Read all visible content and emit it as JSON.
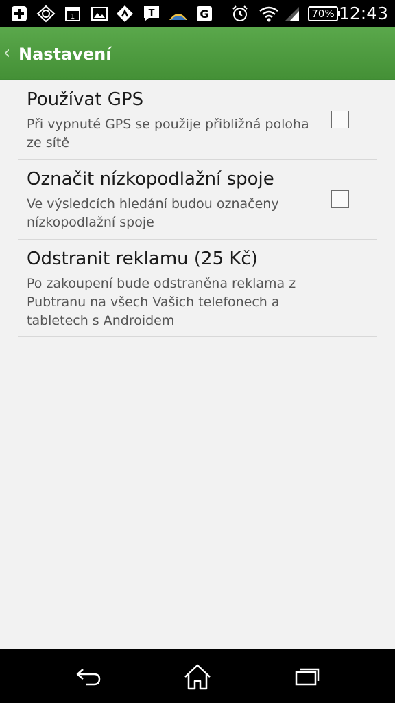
{
  "status_bar": {
    "time": "12:43",
    "battery_percent": "70%",
    "icons": [
      "add-icon",
      "app-icon",
      "calendar-icon",
      "gallery-icon",
      "map-icon",
      "message-icon",
      "weather-icon",
      "g-icon",
      "alarm-icon",
      "wifi-icon",
      "signal-icon",
      "battery-icon"
    ]
  },
  "action_bar": {
    "back_glyph": "‹",
    "title": "Nastavení",
    "color": "#4c9d3f"
  },
  "preferences": [
    {
      "title": "Používat GPS",
      "summary": "Při vypnuté GPS se použije přibližná poloha ze sítě",
      "has_checkbox": true,
      "checked": false
    },
    {
      "title": "Označit nízkopodlažní spoje",
      "summary": "Ve výsledcích hledání budou označeny nízkopodlažní spoje",
      "has_checkbox": true,
      "checked": false
    },
    {
      "title": "Odstranit reklamu (25 Kč)",
      "summary": "Po zakoupení bude odstraněna reklama z Pubtranu na všech Vašich telefonech a tabletech s Androidem",
      "has_checkbox": false
    }
  ],
  "nav_bar": {
    "icons": [
      "back-icon",
      "home-icon",
      "recent-apps-icon"
    ]
  }
}
